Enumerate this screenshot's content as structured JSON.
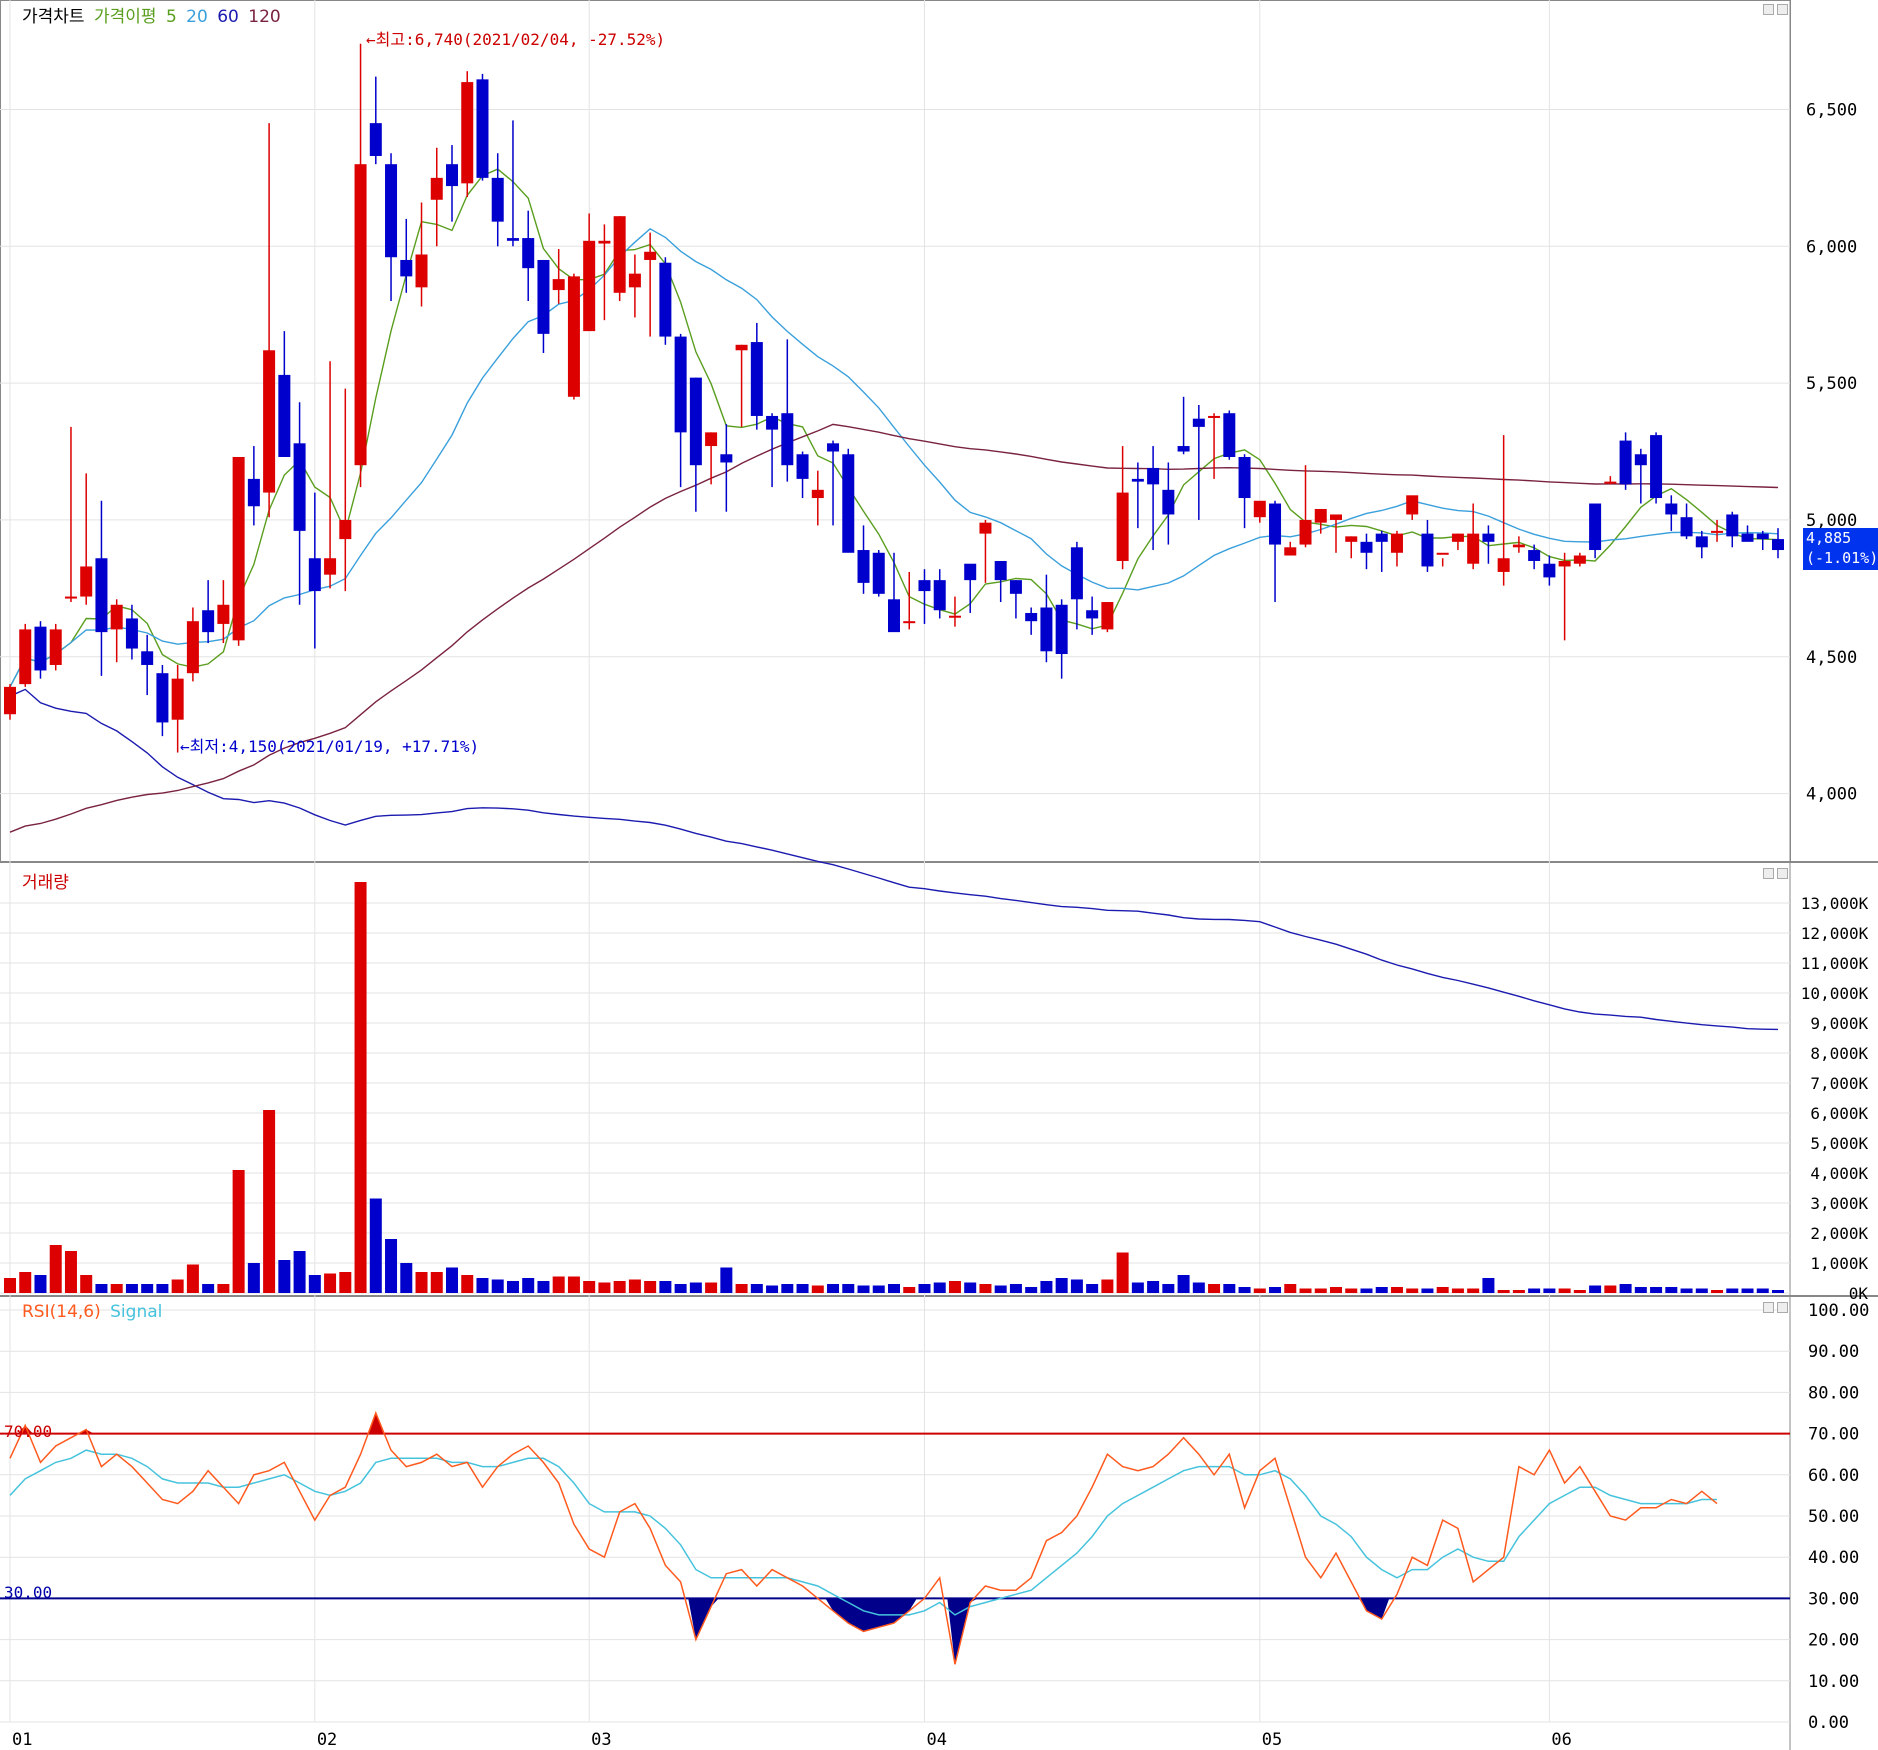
{
  "price_panel": {
    "title": "가격차트",
    "ma_label": "가격이평",
    "ma_periods": [
      "5",
      "20",
      "60",
      "120"
    ],
    "ma_colors": [
      "#5a9e1e",
      "#3aa0dc",
      "#1b1bb0",
      "#7a2340"
    ],
    "up_color": "#dd0000",
    "down_color": "#0000cc",
    "y_ticks": [
      "6,500",
      "6,000",
      "5,500",
      "5,000",
      "4,500",
      "4,000"
    ],
    "high_annotation": "←최고:6,740(2021/02/04, -27.52%)",
    "low_annotation": "←최저:4,150(2021/01/19, +17.71%)",
    "current_price": "4,885",
    "current_change": "(-1.01%)"
  },
  "volume_panel": {
    "title": "거래량",
    "y_ticks": [
      "13,000K",
      "12,000K",
      "11,000K",
      "10,000K",
      "9,000K",
      "8,000K",
      "7,000K",
      "6,000K",
      "5,000K",
      "4,000K",
      "3,000K",
      "2,000K",
      "1,000K",
      "0K"
    ]
  },
  "rsi_panel": {
    "title": "RSI(14,6)",
    "signal_label": "Signal",
    "rsi_color": "#ff5a1e",
    "signal_color": "#46c3dc",
    "y_ticks": [
      "100.00",
      "90.00",
      "80.00",
      "70.00",
      "60.00",
      "50.00",
      "40.00",
      "30.00",
      "20.00",
      "10.00",
      "0.00"
    ],
    "upper_line_label": "70.00",
    "lower_line_label": "30.00"
  },
  "x_ticks": [
    "01",
    "02",
    "03",
    "04",
    "05",
    "06"
  ],
  "chart_data": [
    {
      "type": "candlestick",
      "title": "가격차트",
      "ylim": [
        3750,
        6900
      ],
      "x_tick_index": {
        "01": 0,
        "02": 20,
        "03": 38,
        "04": 60,
        "05": 82,
        "06": 101
      },
      "ohlc": [
        [
          4290,
          4400,
          4270,
          4390
        ],
        [
          4400,
          4620,
          4390,
          4600
        ],
        [
          4610,
          4630,
          4420,
          4450
        ],
        [
          4470,
          4620,
          4450,
          4600
        ],
        [
          4720,
          5340,
          4700,
          4720
        ],
        [
          4720,
          5170,
          4690,
          4830
        ],
        [
          4860,
          5070,
          4430,
          4590
        ],
        [
          4600,
          4710,
          4480,
          4690
        ],
        [
          4640,
          4690,
          4490,
          4530
        ],
        [
          4520,
          4580,
          4360,
          4470
        ],
        [
          4440,
          4470,
          4210,
          4260
        ],
        [
          4270,
          4470,
          4150,
          4420
        ],
        [
          4440,
          4680,
          4410,
          4630
        ],
        [
          4670,
          4780,
          4550,
          4590
        ],
        [
          4620,
          4780,
          4550,
          4690
        ],
        [
          4560,
          5230,
          4540,
          5230
        ],
        [
          5150,
          5270,
          4980,
          5050
        ],
        [
          5100,
          6450,
          5010,
          5620
        ],
        [
          5530,
          5690,
          5260,
          5230
        ],
        [
          5280,
          5430,
          4690,
          4960
        ],
        [
          4860,
          5100,
          4530,
          4740
        ],
        [
          4800,
          5580,
          4750,
          4860
        ],
        [
          4930,
          5480,
          4740,
          5000
        ],
        [
          5200,
          6740,
          5120,
          6300
        ],
        [
          6450,
          6620,
          6300,
          6330
        ],
        [
          6300,
          6340,
          5800,
          5960
        ],
        [
          5950,
          6100,
          5830,
          5890
        ],
        [
          5850,
          6160,
          5780,
          5970
        ],
        [
          6170,
          6360,
          6000,
          6250
        ],
        [
          6300,
          6370,
          6090,
          6220
        ],
        [
          6230,
          6640,
          6180,
          6600
        ],
        [
          6610,
          6630,
          6240,
          6250
        ],
        [
          6250,
          6340,
          6000,
          6090
        ],
        [
          6030,
          6460,
          6000,
          6020
        ],
        [
          6030,
          6130,
          5800,
          5920
        ],
        [
          5950,
          5950,
          5610,
          5680
        ],
        [
          5840,
          5990,
          5790,
          5880
        ],
        [
          5450,
          5900,
          5440,
          5890
        ],
        [
          5690,
          6120,
          5750,
          6020
        ],
        [
          6010,
          6080,
          5730,
          6020
        ],
        [
          5830,
          6110,
          5800,
          6110
        ],
        [
          5850,
          5970,
          5740,
          5900
        ],
        [
          5950,
          6050,
          5670,
          5980
        ],
        [
          5940,
          5960,
          5640,
          5670
        ],
        [
          5670,
          5680,
          5120,
          5320
        ],
        [
          5520,
          5520,
          5030,
          5200
        ],
        [
          5270,
          5320,
          5130,
          5320
        ],
        [
          5240,
          5350,
          5030,
          5210
        ],
        [
          5620,
          5640,
          5340,
          5640
        ],
        [
          5650,
          5720,
          5330,
          5380
        ],
        [
          5380,
          5390,
          5120,
          5330
        ],
        [
          5390,
          5660,
          5140,
          5200
        ],
        [
          5240,
          5250,
          5080,
          5150
        ],
        [
          5080,
          5180,
          4980,
          5110
        ],
        [
          5280,
          5290,
          4980,
          5250
        ],
        [
          5240,
          5260,
          4890,
          4880
        ],
        [
          4890,
          4980,
          4730,
          4770
        ],
        [
          4880,
          4890,
          4720,
          4730
        ],
        [
          4710,
          4880,
          4600,
          4590
        ],
        [
          4630,
          4810,
          4600,
          4630
        ],
        [
          4780,
          4820,
          4620,
          4740
        ],
        [
          4780,
          4820,
          4640,
          4670
        ],
        [
          4650,
          4720,
          4610,
          4650
        ],
        [
          4840,
          4810,
          4660,
          4780
        ],
        [
          4950,
          5000,
          4770,
          4990
        ],
        [
          4850,
          4850,
          4700,
          4780
        ],
        [
          4780,
          4780,
          4640,
          4730
        ],
        [
          4660,
          4680,
          4580,
          4630
        ],
        [
          4680,
          4800,
          4480,
          4520
        ],
        [
          4690,
          4710,
          4420,
          4510
        ],
        [
          4900,
          4920,
          4600,
          4710
        ],
        [
          4670,
          4720,
          4580,
          4640
        ],
        [
          4600,
          4630,
          4590,
          4700
        ],
        [
          4850,
          5270,
          4820,
          5100
        ],
        [
          5150,
          5210,
          4970,
          5140
        ],
        [
          5190,
          5270,
          4890,
          5130
        ],
        [
          5110,
          5210,
          4910,
          5020
        ],
        [
          5270,
          5450,
          5240,
          5250
        ],
        [
          5370,
          5420,
          5000,
          5340
        ],
        [
          5380,
          5390,
          5150,
          5380
        ],
        [
          5390,
          5400,
          5220,
          5230
        ],
        [
          5230,
          5240,
          4970,
          5080
        ],
        [
          5010,
          5060,
          4990,
          5070
        ],
        [
          5060,
          5070,
          4700,
          4910
        ],
        [
          4870,
          4920,
          4870,
          4900
        ],
        [
          4910,
          5200,
          4900,
          5000
        ],
        [
          4990,
          5030,
          4950,
          5040
        ],
        [
          5000,
          5010,
          4880,
          5020
        ],
        [
          4920,
          4940,
          4860,
          4940
        ],
        [
          4920,
          4950,
          4820,
          4880
        ],
        [
          4950,
          4960,
          4810,
          4920
        ],
        [
          4880,
          4960,
          4830,
          4950
        ],
        [
          5020,
          5080,
          5000,
          5090
        ],
        [
          4950,
          5000,
          4810,
          4830
        ],
        [
          4880,
          4860,
          4830,
          4880
        ],
        [
          4920,
          4950,
          4890,
          4950
        ],
        [
          4840,
          5060,
          4820,
          4950
        ],
        [
          4950,
          4980,
          4840,
          4920
        ],
        [
          4810,
          5310,
          4760,
          4860
        ],
        [
          4900,
          4940,
          4880,
          4910
        ],
        [
          4890,
          4910,
          4820,
          4850
        ],
        [
          4840,
          4870,
          4760,
          4790
        ],
        [
          4830,
          4880,
          4560,
          4850
        ],
        [
          4840,
          4880,
          4830,
          4870
        ],
        [
          5060,
          5020,
          4860,
          4890
        ],
        [
          5140,
          5160,
          5130,
          5140
        ],
        [
          5290,
          5320,
          5110,
          5130
        ],
        [
          5240,
          5260,
          5060,
          5200
        ],
        [
          5310,
          5320,
          5060,
          5080
        ],
        [
          5060,
          5090,
          4960,
          5020
        ],
        [
          5010,
          5060,
          4930,
          4940
        ],
        [
          4940,
          4960,
          4860,
          4900
        ],
        [
          4960,
          5000,
          4920,
          4960
        ],
        [
          5020,
          5030,
          4900,
          4940
        ],
        [
          4950,
          4980,
          4940,
          4920
        ],
        [
          4950,
          4960,
          4890,
          4930
        ],
        [
          4930,
          4970,
          4860,
          4890
        ]
      ]
    },
    {
      "type": "bar",
      "title": "거래량",
      "ylim": [
        0,
        13500
      ],
      "unit": "K",
      "values": [
        500,
        700,
        600,
        1600,
        1400,
        600,
        300,
        300,
        300,
        300,
        300,
        450,
        950,
        300,
        300,
        4100,
        1000,
        6100,
        1100,
        1400,
        600,
        650,
        700,
        13700,
        3150,
        1800,
        1000,
        700,
        700,
        850,
        600,
        500,
        450,
        400,
        500,
        400,
        550,
        550,
        400,
        350,
        400,
        450,
        400,
        400,
        300,
        350,
        350,
        850,
        300,
        300,
        250,
        300,
        300,
        250,
        300,
        300,
        250,
        250,
        300,
        200,
        300,
        350,
        400,
        350,
        300,
        250,
        300,
        200,
        400,
        500,
        450,
        300,
        450,
        1350,
        350,
        400,
        300,
        600,
        350,
        300,
        300,
        200,
        150,
        200,
        300,
        150,
        150,
        200,
        150,
        150,
        200,
        200,
        150,
        150,
        200,
        150,
        150,
        500,
        100,
        100,
        150,
        150,
        150,
        100,
        250,
        250,
        300,
        200,
        200,
        200,
        150,
        150,
        100,
        150,
        150,
        150,
        100
      ]
    },
    {
      "type": "line",
      "title": "RSI(14,6)",
      "ylim": [
        0,
        100
      ],
      "hlines": [
        70,
        30
      ],
      "series": [
        {
          "name": "RSI(14,6)",
          "values": [
            64,
            72,
            63,
            67,
            69,
            71,
            62,
            65,
            62,
            58,
            54,
            53,
            56,
            61,
            57,
            53,
            60,
            61,
            63,
            56,
            49,
            55,
            57,
            65,
            75,
            66,
            62,
            63,
            65,
            62,
            63,
            57,
            62,
            65,
            67,
            63,
            58,
            48,
            42,
            40,
            51,
            53,
            47,
            38,
            34,
            20,
            28,
            36,
            37,
            33,
            37,
            35,
            33,
            30,
            27,
            24,
            22,
            23,
            24,
            27,
            30,
            35,
            14,
            29,
            33,
            32,
            32,
            35,
            44,
            46,
            50,
            57,
            65,
            62,
            61,
            62,
            65,
            69,
            65,
            60,
            65,
            52,
            61,
            64,
            52,
            40,
            35,
            41,
            34,
            27,
            25,
            31,
            40,
            38,
            49,
            47,
            34,
            37,
            40,
            62,
            60,
            66,
            58,
            62,
            56,
            50,
            49,
            52,
            52,
            54,
            53,
            56,
            53
          ]
        },
        {
          "name": "Signal",
          "values": [
            55,
            59,
            61,
            63,
            64,
            66,
            65,
            65,
            64,
            62,
            59,
            58,
            58,
            58,
            57,
            57,
            58,
            59,
            60,
            58,
            56,
            55,
            56,
            58,
            63,
            64,
            64,
            64,
            64,
            63,
            63,
            62,
            62,
            63,
            64,
            64,
            62,
            58,
            53,
            51,
            51,
            51,
            50,
            47,
            43,
            37,
            35,
            35,
            35,
            35,
            35,
            35,
            34,
            33,
            31,
            29,
            27,
            26,
            26,
            26,
            27,
            29,
            26,
            28,
            29,
            30,
            31,
            32,
            35,
            38,
            41,
            45,
            50,
            53,
            55,
            57,
            59,
            61,
            62,
            62,
            62,
            60,
            60,
            61,
            59,
            55,
            50,
            48,
            45,
            40,
            37,
            35,
            37,
            37,
            40,
            42,
            40,
            39,
            39,
            45,
            49,
            53,
            55,
            57,
            57,
            55,
            54,
            53,
            53,
            53,
            53,
            54,
            54
          ]
        }
      ]
    }
  ]
}
